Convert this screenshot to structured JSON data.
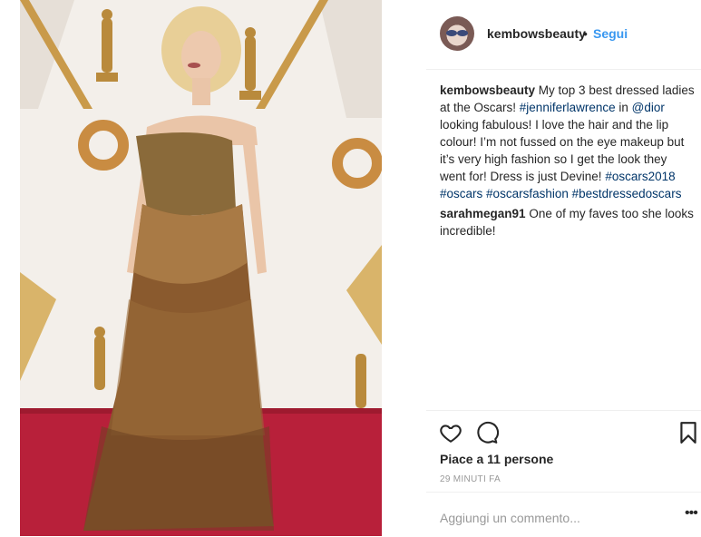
{
  "post": {
    "author": "kembowsbeauty",
    "separator": "•",
    "follow_label": "Segui"
  },
  "caption": {
    "username": "kembowsbeauty",
    "text_1": " My top 3 best dressed ladies at the Oscars! ",
    "tag_1": "#jenniferlawrence",
    "text_2": " in ",
    "mention": "@dior",
    "text_3": " looking fabulous! I love the hair and the lip colour! I’m not fussed on the eye makeup but it’s very high fashion so I get the look they went for! Dress is just Devine! ",
    "tag_2": "#oscars2018",
    "tag_3": "#oscars",
    "tag_4": "#oscarsfashion",
    "tag_5": "#bestdressedoscars"
  },
  "reply": {
    "username": "sarahmegan91",
    "text": " One of my faves too she looks incredible!"
  },
  "actions": {
    "like_icon": "heart-icon",
    "comment_icon": "comment-icon",
    "save_icon": "bookmark-icon",
    "likes_text": "Piace a 11 persone",
    "time_text": "29 MINUTI FA"
  },
  "comment_box": {
    "placeholder": "Aggiungi un commento...",
    "more_label": "•••"
  },
  "colors": {
    "link": "#003569",
    "follow": "#3897f0",
    "carpet": "#b8203a",
    "gown": "#8a5a2e"
  }
}
